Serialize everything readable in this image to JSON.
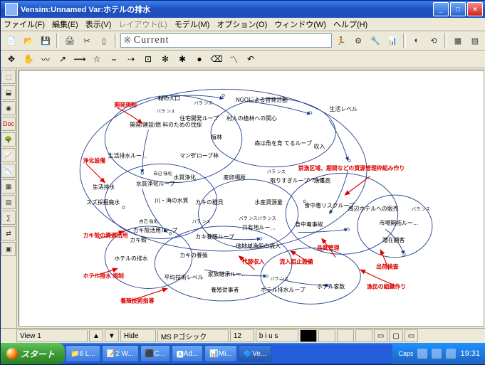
{
  "title": "Vensim:Unnamed Var:ホテルの排水",
  "menu": {
    "file": "ファイル(F)",
    "edit": "編集(E)",
    "view": "表示(V)",
    "layout": "レイアウト(L)",
    "model": "モデル(M)",
    "options": "オプション(O)",
    "window": "ウィンドウ(W)",
    "help": "ヘルプ(H)"
  },
  "toolbar1": {
    "var_label": "※",
    "var_value": "Current"
  },
  "status": {
    "view": "View 1",
    "hide": "Hide",
    "font": "MS Pゴシック",
    "size": "12",
    "attrs": "b i u s"
  },
  "taskbar": {
    "start": "スタート",
    "btn1": "6 L...",
    "btn2": "2 W...",
    "btn3": "C...",
    "btn4": "Ad...",
    "btn5": "Mi...",
    "btn6": "Ve...",
    "clock": "19:31",
    "tray_label": "Caps"
  },
  "nodes": {
    "n1": "村の人口",
    "n2": "NGOによる啓発活動",
    "n3": "生活レベル",
    "n4": "開発規制",
    "n5": "開発/建設/燃\n料のための伐採",
    "n6": "住宅開発ループ",
    "n7": "村人の植林への関心",
    "n8": "植林",
    "n9": "森は魚を育\nてるループ",
    "n10": "収入",
    "n11": "浄化設備",
    "n12": "生活排水ルー…",
    "n13": "マングローブ林",
    "n14": "生活排水",
    "n15": "自己\n強化",
    "n16": "水質浄化",
    "n17": "産卵場所",
    "n18": "取りすぎループ",
    "n19": "漁獲高",
    "n20": "水質浄化ループ",
    "n21": "スズ採掘廃水",
    "n22": "川・海の水質",
    "n23": "カキの稚貝",
    "n24": "水産資源量",
    "n25": "食中毒リスクループ",
    "n26": "周辺ホテルへの販売",
    "n27": "市場開拓ルー…",
    "n28": "カキ殻の資源活用",
    "n29": "自己\n強化",
    "n30": "カキ殻活用ループ",
    "n31": "カキ殻",
    "n32": "カキ養殖ループ",
    "n33": "共有地ルー…",
    "n34": "食中毒事故",
    "n35": "品質管理",
    "n36": "潜在顧客",
    "n37": "他地域漁船の流入",
    "n38": "ホテルの排水",
    "n39": "カキの養殖",
    "n40": "代替収入",
    "n41": "流入阻止設備",
    "n42": "出荷検査",
    "n43": "ホテル排水\n規制",
    "n44": "平均技術レベル",
    "n45": "家族継承ルー…",
    "n46": "漁民の組織作り",
    "n47": "養殖技術指導",
    "n48": "養殖従事者",
    "n49": "ホテル排水ループ",
    "n50": "ホテル客数",
    "n51": "禁漁区域、期間などの資源管理枠組み作り",
    "b1": "バラ\nンス",
    "b2": "バラ\nンス",
    "b3": "バラ\nンス",
    "b4": "バラ\nンス",
    "b5": "バラ\nンス",
    "b6": "バラ\nンス",
    "b7": "バラ\nンス",
    "b8": "バラ\nンス",
    "b9": "バラ\nンス"
  }
}
